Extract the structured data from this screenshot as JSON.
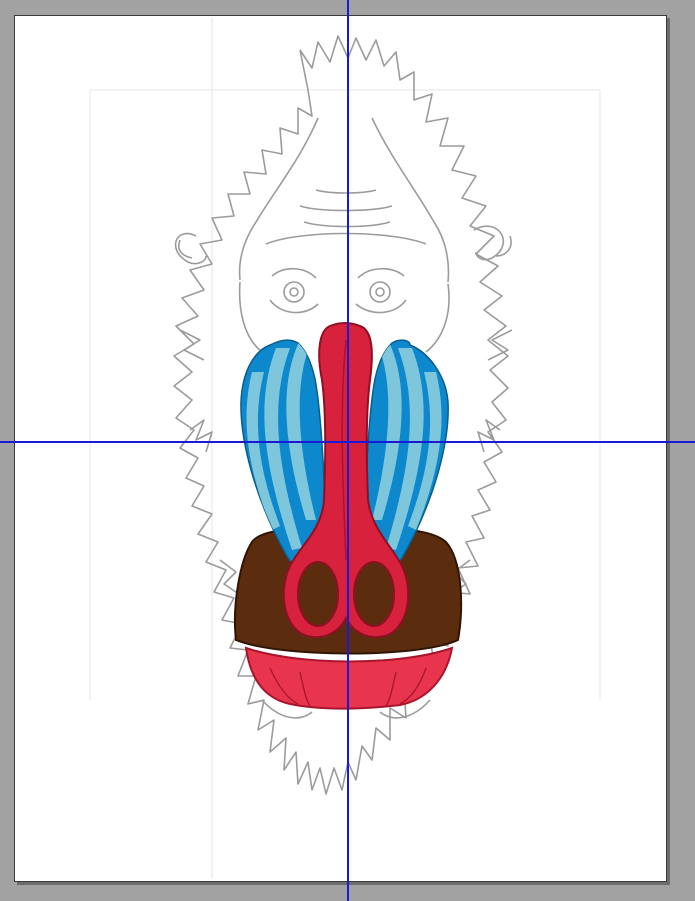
{
  "canvas": {
    "workspace_color": "#a2a2a2",
    "artboard_color": "#ffffff",
    "guide_color": "#1a1ad6"
  },
  "artwork": {
    "subject": "mandrill face",
    "colors": {
      "sketch": "#9b9b9b",
      "nose_red": "#d8213d",
      "nose_shadow": "#a9152d",
      "cheek_blue": "#0d88cc",
      "cheek_light": "#7dc6dc",
      "muzzle_brown": "#5b2d0e",
      "chin_red": "#e8344c"
    }
  },
  "guides": [
    {
      "orientation": "vertical"
    },
    {
      "orientation": "horizontal"
    }
  ]
}
